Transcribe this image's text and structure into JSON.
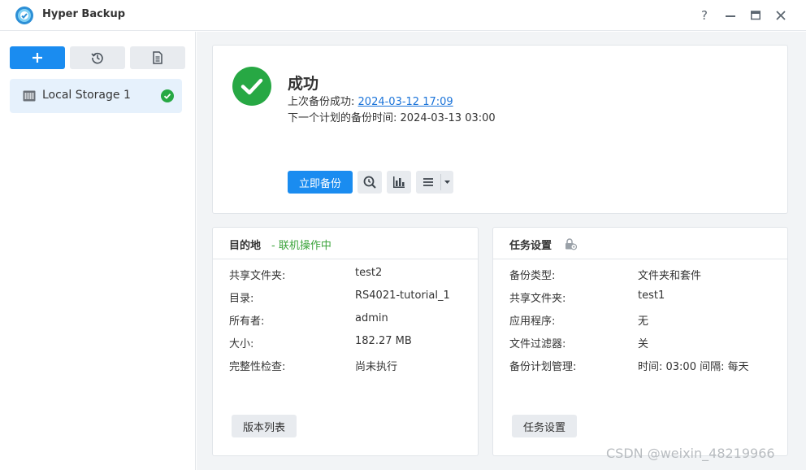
{
  "window": {
    "title": "Hyper Backup",
    "controls": {
      "help": "?",
      "minimize": "minimize",
      "maximize": "maximize",
      "close": "close"
    }
  },
  "sidebar": {
    "toolbar": [
      {
        "icon": "plus-icon",
        "style": "primary"
      },
      {
        "icon": "restore-history-icon",
        "style": "default"
      },
      {
        "icon": "document-log-icon",
        "style": "default"
      }
    ],
    "tasks": [
      {
        "label": "Local Storage 1",
        "icon": "storage-icon",
        "status_icon": "success-check-icon",
        "selected": true
      }
    ]
  },
  "status": {
    "title": "成功",
    "last_backup_label": "上次备份成功:",
    "last_backup_time": "2024-03-12 17:09",
    "next_backup_label": "下一个计划的备份时间:",
    "next_backup_time": "2024-03-13 03:00",
    "backup_now_button": "立即备份",
    "icon_buttons": [
      "version-browser-icon",
      "statistics-icon",
      "menu-icon"
    ]
  },
  "destination": {
    "title": "目的地",
    "status": "- 联机操作中",
    "rows": [
      {
        "key": "共享文件夹:",
        "value": "test2"
      },
      {
        "key": "目录:",
        "value": "RS4021-tutorial_1"
      },
      {
        "key": "所有者:",
        "value": "admin"
      },
      {
        "key": "大小:",
        "value": "182.27 MB"
      },
      {
        "key": "完整性检查:",
        "value": "尚未执行"
      }
    ],
    "button": "版本列表"
  },
  "task_settings": {
    "title": "任务设置",
    "rows": [
      {
        "key": "备份类型:",
        "value": "文件夹和套件"
      },
      {
        "key": "共享文件夹:",
        "value": "test1"
      },
      {
        "key": "应用程序:",
        "value": "无"
      },
      {
        "key": "文件过滤器:",
        "value": "关"
      },
      {
        "key": "备份计划管理:",
        "value": "时间: 03:00 间隔: 每天"
      }
    ],
    "button": "任务设置"
  },
  "watermark": "CSDN @weixin_48219966",
  "colors": {
    "accent": "#1a8cf0",
    "success": "#27a844",
    "online_green": "#3aa33a",
    "link": "#1a73d9",
    "background": "#f2f4f6"
  }
}
